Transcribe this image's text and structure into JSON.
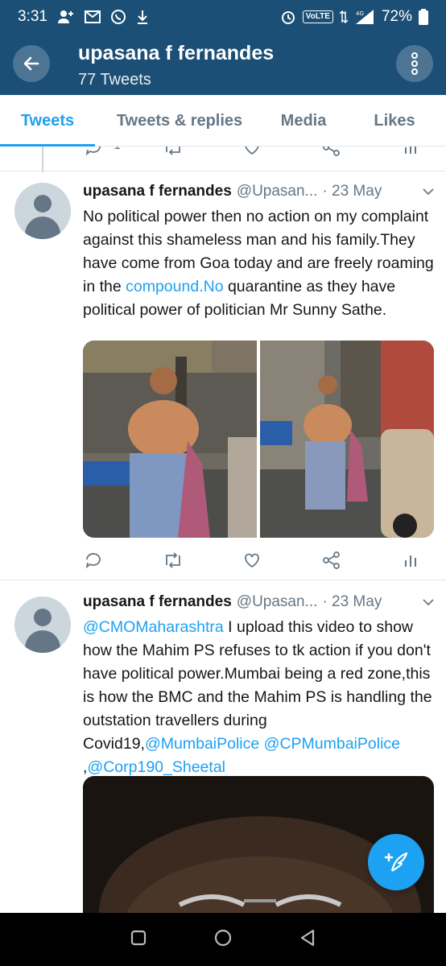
{
  "status_bar": {
    "time": "3:31",
    "network": "VoLTE",
    "signal_label": "4G",
    "battery": "72%"
  },
  "header": {
    "title": "upasana f fernandes",
    "subtitle": "77 Tweets"
  },
  "tabs": [
    {
      "label": "Tweets",
      "active": true
    },
    {
      "label": "Tweets & replies",
      "active": false
    },
    {
      "label": "Media",
      "active": false
    },
    {
      "label": "Likes",
      "active": false
    }
  ],
  "previous_tweet": {
    "reply_count": "1"
  },
  "tweets": [
    {
      "name": "upasana f fernandes",
      "handle": "@Upasan...",
      "date": "· 23 May",
      "text_before_link": "No political power then no action on my complaint against this shameless man and his family.They have come from Goa today and are freely roaming in the ",
      "link": "compound.No",
      "text_after_link": " quarantine as they have political power of politician Mr Sunny Sathe.",
      "media": [
        "photo",
        "photo"
      ]
    },
    {
      "name": "upasana f fernandes",
      "handle": "@Upasan...",
      "date": "· 23 May",
      "mention1": "@CMOMaharashtra",
      "text_body": " I upload this video to show how the Mahim PS refuses to tk action if you don't have political power.Mumbai being a red zone,this is how the BMC and the Mahim PS is handling the outstation travellers during Covid19,",
      "mention2": "@MumbaiPolice",
      "mention3": "@CPMumbaiPolice",
      "separator": " ,",
      "mention4": "@Corp190_Sheetal",
      "media": [
        "video"
      ]
    }
  ],
  "icons": {
    "back": "arrow-left-icon",
    "more": "more-vertical-icon",
    "reply": "reply-icon",
    "retweet": "retweet-icon",
    "like": "heart-icon",
    "share": "share-icon",
    "analytics": "analytics-icon",
    "compose": "compose-icon"
  },
  "colors": {
    "header_bg": "#1b4f75",
    "accent": "#1da1f2",
    "secondary_text": "#657786"
  }
}
